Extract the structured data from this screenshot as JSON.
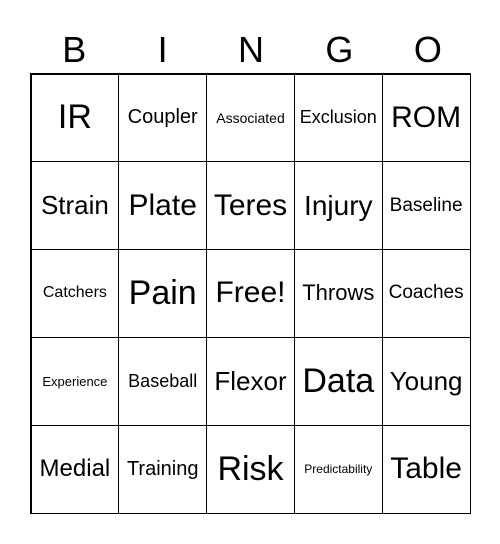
{
  "header": [
    "B",
    "I",
    "N",
    "G",
    "O"
  ],
  "cells": [
    "IR",
    "Coupler",
    "Associated",
    "Exclusion",
    "ROM",
    "Strain",
    "Plate",
    "Teres",
    "Injury",
    "Baseline",
    "Catchers",
    "Pain",
    "Free!",
    "Throws",
    "Coaches",
    "Experience",
    "Baseball",
    "Flexor",
    "Data",
    "Young",
    "Medial",
    "Training",
    "Risk",
    "Predictability",
    "Table"
  ]
}
